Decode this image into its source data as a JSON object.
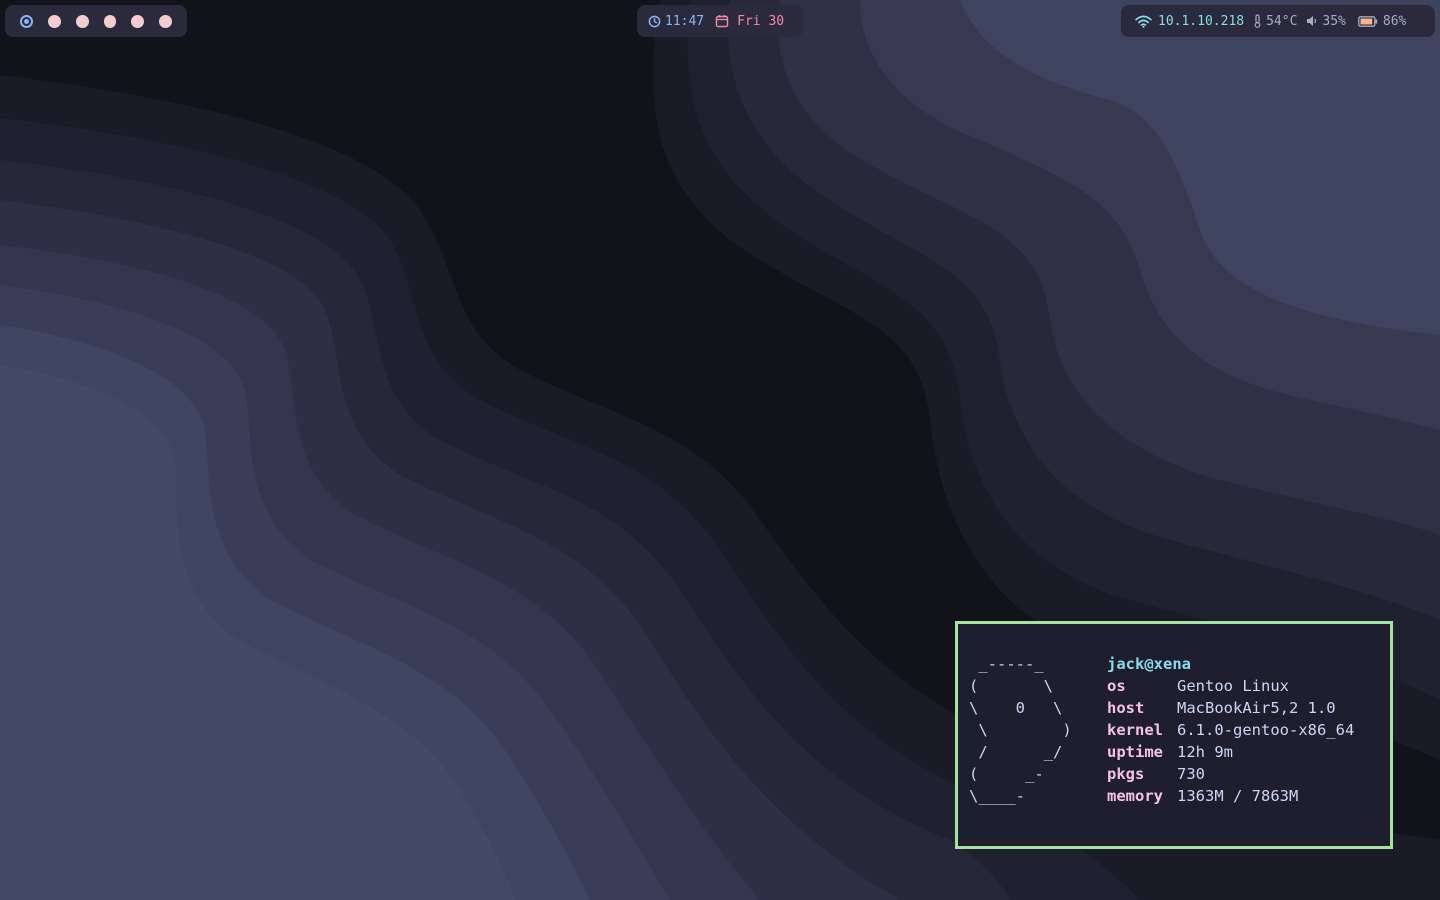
{
  "topbar": {
    "workspaces": [
      {
        "id": 1,
        "active": true
      },
      {
        "id": 2,
        "active": false
      },
      {
        "id": 3,
        "active": false
      },
      {
        "id": 4,
        "active": false
      },
      {
        "id": 5,
        "active": false
      },
      {
        "id": 6,
        "active": false
      }
    ],
    "clock": {
      "time": "11:47",
      "date": "Fri 30",
      "clock_icon": "clock-icon",
      "calendar_icon": "calendar-icon"
    },
    "status": {
      "ip": "10.1.10.218",
      "temperature": "54°C",
      "volume": "35%",
      "battery": "86%",
      "wifi_icon": "wifi-icon",
      "thermometer_icon": "thermometer-icon",
      "speaker_icon": "speaker-icon",
      "battery_icon": "battery-icon"
    }
  },
  "fetch": {
    "ascii_logo": " _-----_\n(       \\\n\\    0   \\\n \\        )\n /      _/\n(     _-\n\\____-",
    "user_host": "jack@xena",
    "rows": [
      {
        "key": "os",
        "value": "Gentoo Linux"
      },
      {
        "key": "host",
        "value": "MacBookAir5,2 1.0"
      },
      {
        "key": "kernel",
        "value": "6.1.0-gentoo-x86_64"
      },
      {
        "key": "uptime",
        "value": "12h 9m"
      },
      {
        "key": "pkgs",
        "value": "730"
      },
      {
        "key": "memory",
        "value": "1363M / 7863M"
      }
    ]
  },
  "colors": {
    "bar_bg": "#2a2a3c",
    "accent_blue": "#89b4fa",
    "accent_pink": "#f38ba8",
    "accent_cyan": "#89dceb",
    "accent_green": "#a6e3a1",
    "key_pink": "#f5c2e7",
    "text": "#cdd6f4",
    "wallpaper_shades": [
      "#12121a",
      "#191922",
      "#1e1f2c",
      "#262839",
      "#2d2f45",
      "#353850",
      "#3f445f"
    ]
  }
}
